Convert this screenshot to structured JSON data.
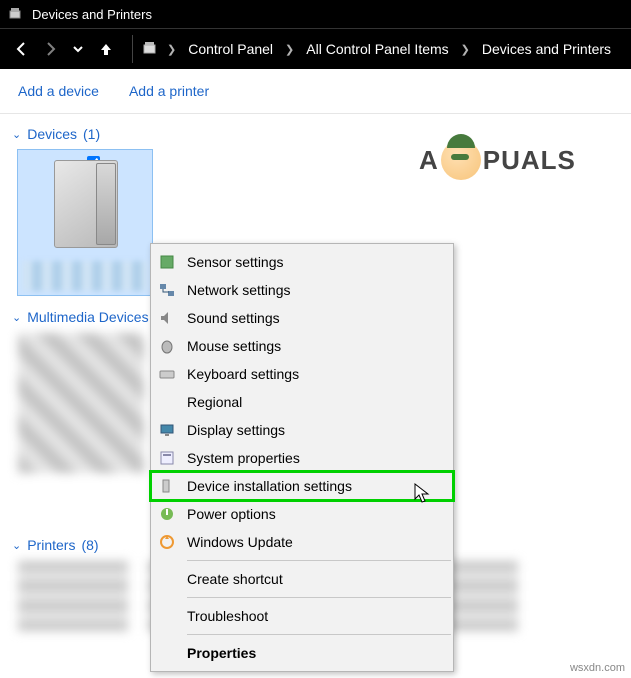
{
  "title": "Devices and Printers",
  "breadcrumb": {
    "items": [
      "Control Panel",
      "All Control Panel Items",
      "Devices and Printers"
    ]
  },
  "commands": {
    "add_device": "Add a device",
    "add_printer": "Add a printer"
  },
  "sections": {
    "devices": {
      "label": "Devices",
      "count": "(1)"
    },
    "multimedia": {
      "label": "Multimedia Devices",
      "count": ""
    },
    "printers": {
      "label": "Printers",
      "count": "(8)"
    }
  },
  "context_menu": {
    "items": [
      {
        "label": "Sensor settings",
        "icon": "sensor-icon"
      },
      {
        "label": "Network settings",
        "icon": "network-icon"
      },
      {
        "label": "Sound settings",
        "icon": "speaker-icon"
      },
      {
        "label": "Mouse settings",
        "icon": "mouse-icon"
      },
      {
        "label": "Keyboard settings",
        "icon": "keyboard-icon"
      },
      {
        "label": "Regional",
        "icon": ""
      },
      {
        "label": "Display settings",
        "icon": "monitor-icon"
      },
      {
        "label": "System properties",
        "icon": "properties-icon"
      },
      {
        "label": "Device installation settings",
        "icon": "install-icon",
        "highlight": true
      },
      {
        "label": "Power options",
        "icon": "power-icon"
      },
      {
        "label": "Windows Update",
        "icon": "update-icon"
      }
    ],
    "after_sep": [
      {
        "label": "Create shortcut"
      },
      {
        "label": "Troubleshoot"
      },
      {
        "label": "Properties",
        "bold": true
      }
    ]
  },
  "watermark": {
    "left": "A",
    "right": "PUALS"
  },
  "source": "wsxdn.com"
}
